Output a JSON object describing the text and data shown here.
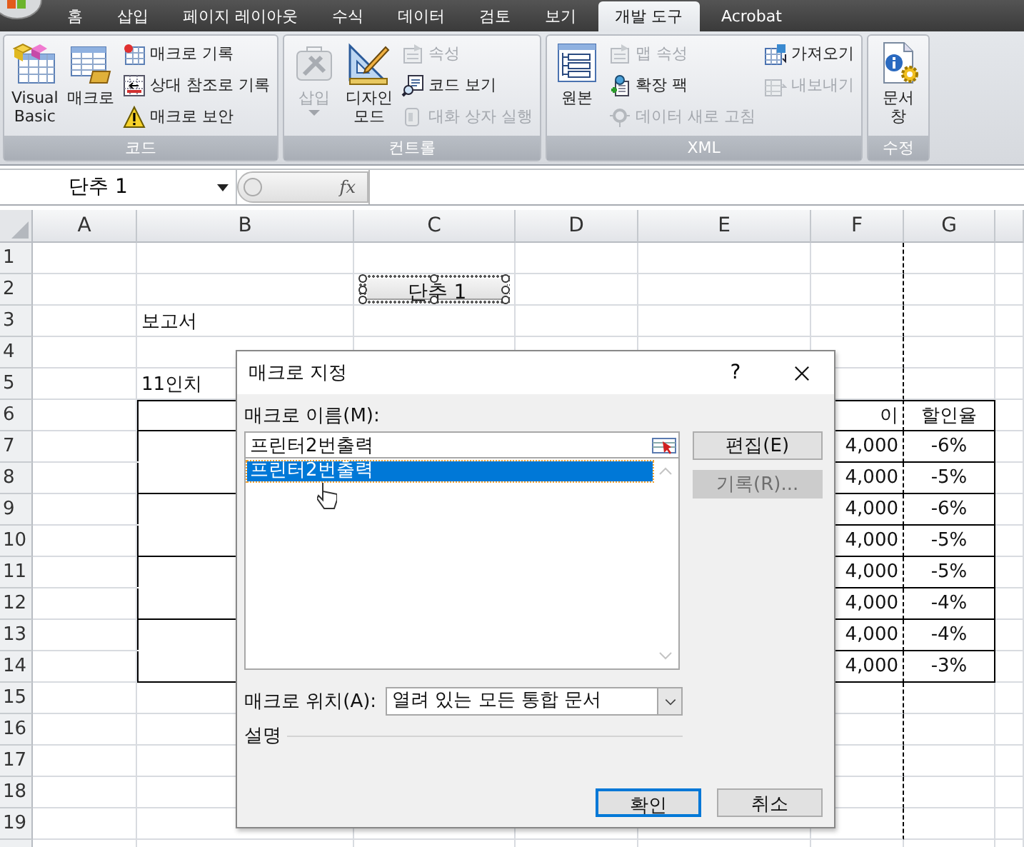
{
  "tabs": [
    {
      "label": "홈",
      "selected": false
    },
    {
      "label": "삽입",
      "selected": false
    },
    {
      "label": "페이지 레이아웃",
      "selected": false
    },
    {
      "label": "수식",
      "selected": false
    },
    {
      "label": "데이터",
      "selected": false
    },
    {
      "label": "검토",
      "selected": false
    },
    {
      "label": "보기",
      "selected": false
    },
    {
      "label": "개발 도구",
      "selected": true
    },
    {
      "label": "Acrobat",
      "selected": false
    }
  ],
  "ribbon": {
    "groups": [
      {
        "label": "코드",
        "columns": [
          {
            "kind": "large",
            "items": [
              {
                "label": "Visual Basic",
                "disabled": false,
                "dropdown": false
              }
            ]
          },
          {
            "kind": "large",
            "items": [
              {
                "label": "매크로",
                "disabled": false,
                "dropdown": false
              }
            ]
          },
          {
            "kind": "small",
            "items": [
              {
                "label": "매크로 기록",
                "disabled": false
              },
              {
                "label": "상대 참조로 기록",
                "disabled": false
              },
              {
                "label": "매크로 보안",
                "disabled": false
              }
            ]
          }
        ]
      },
      {
        "label": "컨트롤",
        "columns": [
          {
            "kind": "large",
            "items": [
              {
                "label": "삽입",
                "disabled": true,
                "dropdown": true
              }
            ]
          },
          {
            "kind": "large",
            "items": [
              {
                "label": "디자인 모드",
                "disabled": false,
                "dropdown": false
              }
            ]
          },
          {
            "kind": "small",
            "items": [
              {
                "label": "속성",
                "disabled": true
              },
              {
                "label": "코드 보기",
                "disabled": false
              },
              {
                "label": "대화 상자 실행",
                "disabled": true
              }
            ]
          }
        ]
      },
      {
        "label": "XML",
        "columns": [
          {
            "kind": "large",
            "items": [
              {
                "label": "원본",
                "disabled": false,
                "dropdown": false
              }
            ]
          },
          {
            "kind": "small",
            "items": [
              {
                "label": "맵 속성",
                "disabled": true
              },
              {
                "label": "확장 팩",
                "disabled": false
              },
              {
                "label": "데이터 새로 고침",
                "disabled": true
              }
            ]
          },
          {
            "kind": "small",
            "items": [
              {
                "label": "가져오기",
                "disabled": false
              },
              {
                "label": "내보내기",
                "disabled": true
              }
            ]
          }
        ]
      },
      {
        "label": "수정",
        "columns": [
          {
            "kind": "large",
            "items": [
              {
                "label": "문서 창",
                "disabled": false,
                "dropdown": false
              }
            ]
          }
        ]
      }
    ]
  },
  "formula_bar": {
    "name_box": "단추 1",
    "fx": "fx"
  },
  "sheet": {
    "columns": [
      "A",
      "B",
      "C",
      "D",
      "E",
      "F",
      "G"
    ],
    "rows": [
      {
        "label": "1",
        "cells": [
          null,
          null,
          null,
          null,
          null,
          null,
          null
        ]
      },
      {
        "label": "2",
        "cells": [
          null,
          null,
          null,
          null,
          null,
          null,
          null
        ]
      },
      {
        "label": "3",
        "cells": [
          null,
          "보고서",
          null,
          null,
          null,
          null,
          null
        ]
      },
      {
        "label": "4",
        "cells": [
          null,
          null,
          null,
          null,
          null,
          null,
          null
        ]
      },
      {
        "label": "5",
        "cells": [
          null,
          "11인치",
          null,
          null,
          null,
          null,
          null
        ]
      },
      {
        "label": "6",
        "bordered": true,
        "merge_above": false,
        "cells": [
          null,
          null,
          null,
          null,
          null,
          "이",
          "할인율"
        ]
      },
      {
        "label": "7",
        "bordered": true,
        "merge_above": false,
        "cells": [
          null,
          null,
          null,
          null,
          null,
          "4,000",
          "-6%"
        ]
      },
      {
        "label": "8",
        "bordered": true,
        "merge_above": true,
        "cells": [
          null,
          null,
          null,
          null,
          null,
          "4,000",
          "-5%"
        ]
      },
      {
        "label": "9",
        "bordered": true,
        "merge_above": false,
        "cells": [
          null,
          null,
          null,
          null,
          null,
          "4,000",
          "-6%"
        ]
      },
      {
        "label": "10",
        "bordered": true,
        "merge_above": true,
        "cells": [
          null,
          null,
          null,
          null,
          null,
          "4,000",
          "-5%"
        ]
      },
      {
        "label": "11",
        "bordered": true,
        "merge_above": false,
        "cells": [
          null,
          null,
          null,
          null,
          null,
          "4,000",
          "-5%"
        ]
      },
      {
        "label": "12",
        "bordered": true,
        "merge_above": true,
        "cells": [
          null,
          null,
          null,
          null,
          null,
          "4,000",
          "-4%"
        ]
      },
      {
        "label": "13",
        "bordered": true,
        "merge_above": false,
        "cells": [
          null,
          null,
          null,
          null,
          null,
          "4,000",
          "-4%"
        ]
      },
      {
        "label": "14",
        "bordered": true,
        "merge_above": true,
        "cells": [
          null,
          null,
          null,
          null,
          null,
          "4,000",
          "-3%"
        ]
      },
      {
        "label": "15",
        "cells": [
          null,
          null,
          null,
          null,
          null,
          null,
          null
        ]
      },
      {
        "label": "16",
        "cells": [
          null,
          null,
          null,
          null,
          null,
          null,
          null
        ]
      },
      {
        "label": "17",
        "cells": [
          null,
          null,
          null,
          null,
          null,
          null,
          null
        ]
      },
      {
        "label": "18",
        "cells": [
          null,
          null,
          null,
          null,
          null,
          null,
          null
        ]
      },
      {
        "label": "19",
        "cells": [
          null,
          null,
          null,
          null,
          null,
          null,
          null
        ]
      }
    ],
    "form_button": {
      "label": "단추 1",
      "selected": true
    }
  },
  "dialog": {
    "title": "매크로 지정",
    "help": "?",
    "name_label": "매크로 이름(M):",
    "name_value": "프린터2번출력",
    "macros": [
      {
        "label": "프린터2번출력",
        "selected": true
      }
    ],
    "side_buttons": [
      {
        "label": "편집(E)",
        "disabled": false
      },
      {
        "label": "기록(R)...",
        "disabled": true
      }
    ],
    "location_label": "매크로 위치(A):",
    "location_value": "열려 있는 모든 통합 문서",
    "description_label": "설명",
    "footer_buttons": [
      {
        "label": "확인",
        "default": true
      },
      {
        "label": "취소",
        "default": false
      }
    ]
  }
}
